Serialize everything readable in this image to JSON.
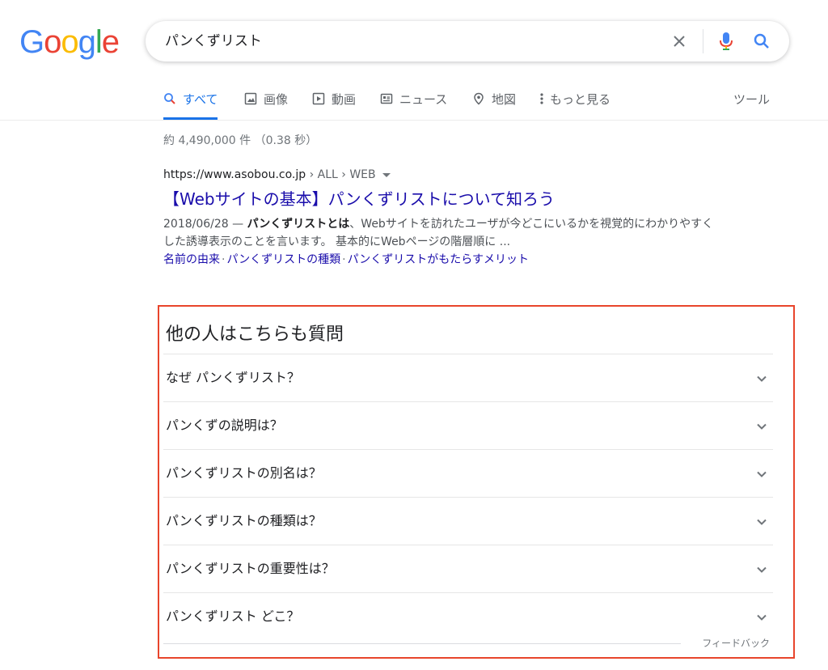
{
  "logo": {
    "letters": [
      "G",
      "o",
      "o",
      "g",
      "l",
      "e"
    ],
    "colors": [
      "#4285F4",
      "#EA4335",
      "#FBBC05",
      "#4285F4",
      "#34A853",
      "#EA4335"
    ]
  },
  "search": {
    "query": "パンくずリスト"
  },
  "icons": {
    "clear": "close-icon",
    "mic": "mic-icon",
    "search": "search-icon"
  },
  "tabs": [
    {
      "label": "すべて",
      "icon": "search-icon",
      "active": true
    },
    {
      "label": "画像",
      "icon": "image-icon"
    },
    {
      "label": "動画",
      "icon": "video-icon"
    },
    {
      "label": "ニュース",
      "icon": "news-icon"
    },
    {
      "label": "地図",
      "icon": "map-pin-icon"
    },
    {
      "label": "もっと見る",
      "icon": "more-vert-icon"
    }
  ],
  "tools_label": "ツール",
  "stats": "約 4,490,000 件 （0.38 秒）",
  "result": {
    "url_host": "https://www.asobou.co.jp",
    "url_path": " › ALL › WEB",
    "title": "【Webサイトの基本】パンくずリストについて知ろう",
    "date": "2018/06/28 — ",
    "snippet_bold": "パンくずリストとは",
    "snippet_rest": "、Webサイトを訪れたユーザが今どこにいるかを視覚的にわかりやすくした誘導表示のことを言います。 基本的にWebページの階層順に ...",
    "sitelinks": [
      "名前の由来",
      "パンくずリストの種類",
      "パンくずリストがもたらすメリット"
    ],
    "sitelink_separator": "·"
  },
  "paa": {
    "title": "他の人はこちらも質問",
    "questions": [
      "なぜ パンくずリスト？",
      "パンくずの説明は？",
      "パンくずリストの別名は？",
      "パンくずリストの種類は？",
      "パンくずリストの重要性は？",
      "パンくずリスト どこ？"
    ],
    "feedback": "フィードバック"
  }
}
